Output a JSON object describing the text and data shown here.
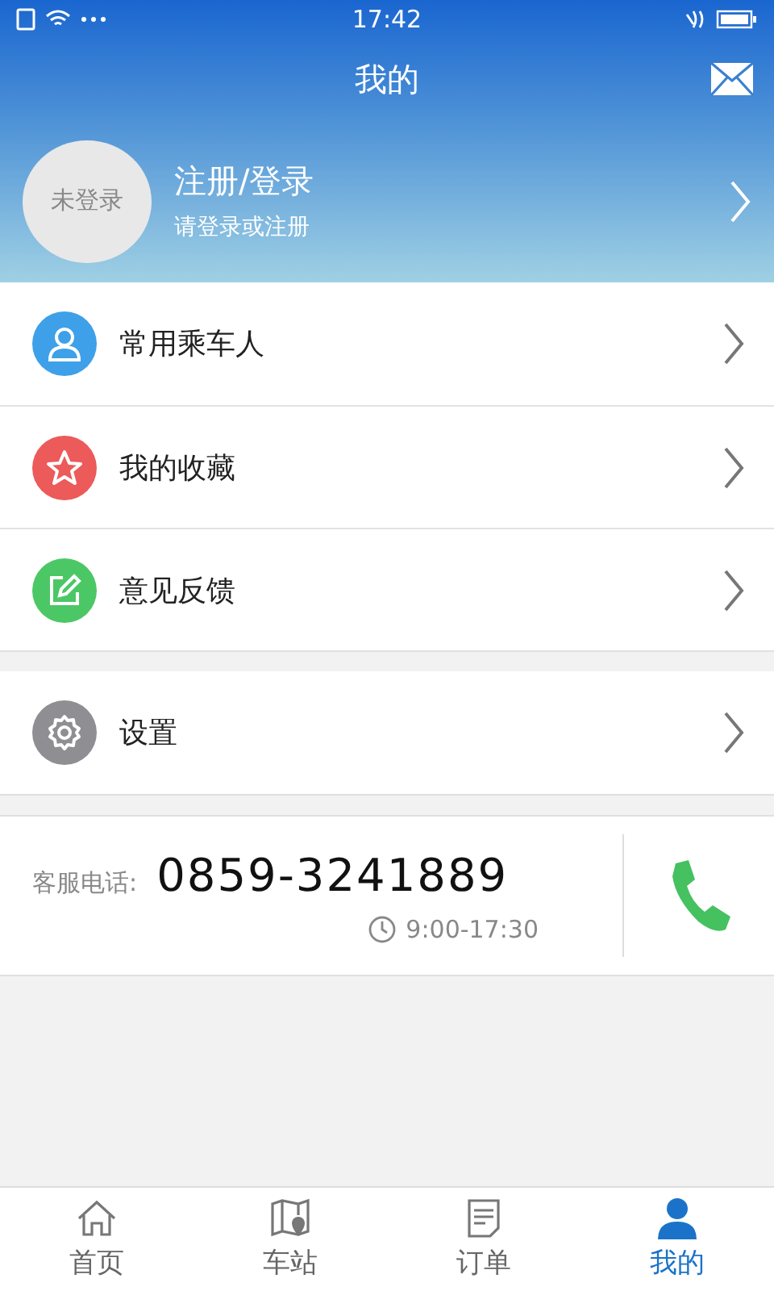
{
  "status_bar": {
    "time": "17:42"
  },
  "header": {
    "title": "我的"
  },
  "profile": {
    "avatar_label": "未登录",
    "title": "注册/登录",
    "subtitle": "请登录或注册"
  },
  "menu_groups": [
    {
      "items": [
        {
          "label": "常用乘车人",
          "kind": "person",
          "color": "#3ea0e8"
        },
        {
          "label": "我的收藏",
          "kind": "star",
          "color": "#ec5a5a"
        },
        {
          "label": "意见反馈",
          "kind": "edit",
          "color": "#4cc765"
        }
      ]
    },
    {
      "items": [
        {
          "label": "设置",
          "kind": "gear",
          "color": "#8e8e93"
        }
      ]
    }
  ],
  "service": {
    "label": "客服电话:",
    "phone": "0859-3241889",
    "hours": "9:00-17:30"
  },
  "tab_bar": [
    {
      "label": "首页",
      "kind": "home",
      "selected": false
    },
    {
      "label": "车站",
      "kind": "map",
      "selected": false
    },
    {
      "label": "订单",
      "kind": "order",
      "selected": false
    },
    {
      "label": "我的",
      "kind": "user",
      "selected": true
    }
  ]
}
